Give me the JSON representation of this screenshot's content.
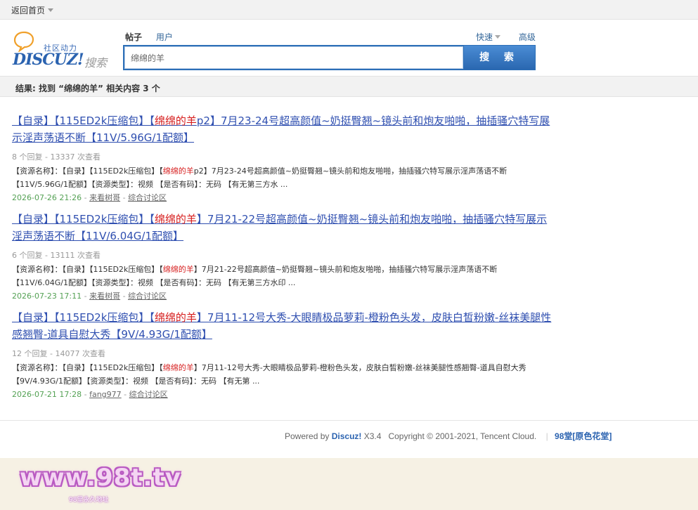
{
  "topbar": {
    "home_label": "返回首页"
  },
  "logo": {
    "slogan": "社区动力",
    "brand": "DISCUZ!",
    "search_word": "搜索"
  },
  "search": {
    "tabs": [
      "帖子",
      "用户"
    ],
    "quick_label": "快速",
    "advanced_label": "高级",
    "query": "绵绵的羊",
    "button_label": "搜 索"
  },
  "result_summary": "结果: 找到 “绵绵的羊” 相关内容 3 个",
  "results": [
    {
      "title_prefix": "【自录】【115ED2k压缩包】【",
      "title_highlight": "绵绵的羊",
      "title_suffix": "p2】7月23-24号超高颜值~奶挺臀翘~镜头前和炮友啪啪，抽插骚穴特写展示淫声荡语不断【11V/5.96G/1配额】",
      "meta": "8 个回复 - 13337 次查看",
      "desc_prefix": "【资源名称】：【自录】【115ED2k压缩包】【",
      "desc_highlight": "绵绵的羊",
      "desc_suffix": "p2】7月23-24号超高颜值~奶挺臀翘~镜头前和炮友啪啪，抽插骚穴特写展示淫声荡语不断【11V/5.96G/1配额】【资源类型】：视频 【是否有码】：无码 【有无第三方水 ...",
      "date": "2026-07-26 21:26",
      "author": "来看树哥",
      "forum": "综合讨论区"
    },
    {
      "title_prefix": "【自录】【115ED2k压缩包】【",
      "title_highlight": "绵绵的羊",
      "title_suffix": "】7月21-22号超高颜值~奶挺臀翘~镜头前和炮友啪啪，抽插骚穴特写展示淫声荡语不断【11V/6.04G/1配额】",
      "meta": "6 个回复 - 13111 次查看",
      "desc_prefix": "【资源名称】：【自录】【115ED2k压缩包】【",
      "desc_highlight": "绵绵的羊",
      "desc_suffix": "】7月21-22号超高颜值~奶挺臀翘~镜头前和炮友啪啪，抽插骚穴特写展示淫声荡语不断【11V/6.04G/1配额】【资源类型】：视频 【是否有码】：无码 【有无第三方水印 ...",
      "date": "2026-07-23 17:11",
      "author": "来看树哥",
      "forum": "综合讨论区"
    },
    {
      "title_prefix": "【自录】【115ED2k压缩包】【",
      "title_highlight": "绵绵的羊",
      "title_suffix": "】7月11-12号大秀-大眼睛极品萝莉-橙粉色头发，皮肤白皙粉嫩-丝袜美腿性感翘臀-道具自慰大秀【9V/4.93G/1配额】",
      "meta": "12 个回复 - 14077 次查看",
      "desc_prefix": "【资源名称】：【自录】【115ED2k压缩包】【",
      "desc_highlight": "绵绵的羊",
      "desc_suffix": "】7月11-12号大秀-大眼睛极品萝莉-橙粉色头发，皮肤白皙粉嫩-丝袜美腿性感翘臀-道具自慰大秀【9V/4.93G/1配额】【资源类型】：视频 【是否有码】：无码 【有无第 ...",
      "date": "2026-07-21 17:28",
      "author": "fang977",
      "forum": "综合讨论区"
    }
  ],
  "footer": {
    "powered_prefix": "Powered by",
    "powered_brand": "Discuz!",
    "version": "X3.4",
    "copyright": "Copyright © 2001-2021, Tencent Cloud.",
    "site_link": "98堂[原色花堂]"
  },
  "watermark": {
    "text": "www.98t.tv",
    "subtext": "98堂永久地址"
  }
}
